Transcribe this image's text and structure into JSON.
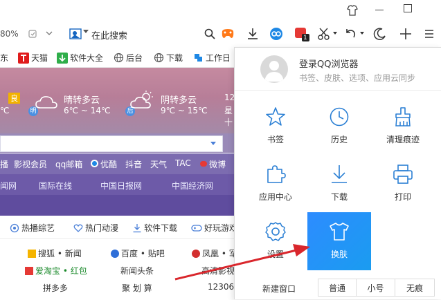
{
  "toolbar": {
    "zoom": "80%",
    "search_placeholder": "在此搜索",
    "badge": "1"
  },
  "bookmarks": [
    {
      "label": "东",
      "icon": "none"
    },
    {
      "label": "天猫",
      "icon": "tmall-icon"
    },
    {
      "label": "软件大全",
      "icon": "download-icon"
    },
    {
      "label": "后台",
      "icon": "globe-icon"
    },
    {
      "label": "下载",
      "icon": "globe-icon"
    },
    {
      "label": "工作日",
      "icon": "tag-icon"
    }
  ],
  "weather": {
    "today": {
      "badge": "良",
      "temp": "℃"
    },
    "tomorrow": {
      "label": "晴转多云",
      "temp": "6℃ ~ 14℃",
      "day": "明"
    },
    "after": {
      "label": "阴转多云",
      "temp": "9℃ ~ 15℃",
      "day": "后"
    },
    "side": [
      "12",
      "星",
      "十"
    ]
  },
  "quicklinks": [
    "播",
    "影视会员",
    "qq邮箱",
    "优酷",
    "抖音",
    "天气",
    "TAC",
    "微博"
  ],
  "channels": [
    "闻网",
    "国际在线",
    "中国日报网",
    "中国经济网"
  ],
  "category_tabs": [
    {
      "label": "热播综艺",
      "icon": "tv-icon"
    },
    {
      "label": "热门动漫",
      "icon": "heart-icon"
    },
    {
      "label": "软件下载",
      "icon": "download-icon"
    },
    {
      "label": "好玩游戏",
      "icon": "gamepad-icon"
    }
  ],
  "sites": {
    "row1": [
      "搜狐 • 新闻",
      "百度 • 贴吧",
      "凤凰 • 军"
    ],
    "row2": [
      "爱淘宝 • 红包",
      "新闻头条",
      "高清影视"
    ],
    "row3": [
      "拼多多",
      "聚 划 算",
      "12306"
    ]
  },
  "menu": {
    "login_title": "登录QQ浏览器",
    "login_sub": "书签、皮肤、选项、应用云同步",
    "items": [
      {
        "label": "书签",
        "icon": "star-icon"
      },
      {
        "label": "历史",
        "icon": "clock-icon"
      },
      {
        "label": "清理痕迹",
        "icon": "broom-icon"
      },
      {
        "label": "应用中心",
        "icon": "puzzle-icon"
      },
      {
        "label": "下载",
        "icon": "download-icon"
      },
      {
        "label": "打印",
        "icon": "printer-icon"
      },
      {
        "label": "设置",
        "icon": "gear-icon"
      },
      {
        "label": "换肤",
        "icon": "tshirt-icon"
      }
    ],
    "new_window": "新建窗口",
    "zoom_options": [
      "普通",
      "小号",
      "无痕"
    ]
  },
  "colors": {
    "accent": "#1e90ff",
    "arrow": "#d9262c"
  }
}
